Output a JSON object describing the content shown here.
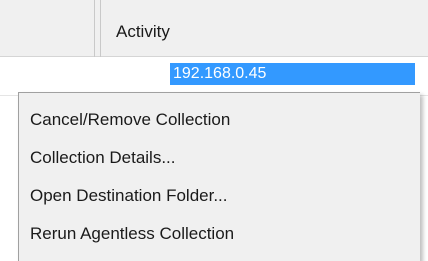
{
  "grid": {
    "column_header": "Activity",
    "selected_cell_text": "192.168.0.45"
  },
  "context_menu": {
    "items": [
      {
        "label": "Cancel/Remove Collection"
      },
      {
        "label": "Collection Details..."
      },
      {
        "label": "Open Destination Folder..."
      },
      {
        "label": "Rerun Agentless Collection"
      }
    ]
  }
}
